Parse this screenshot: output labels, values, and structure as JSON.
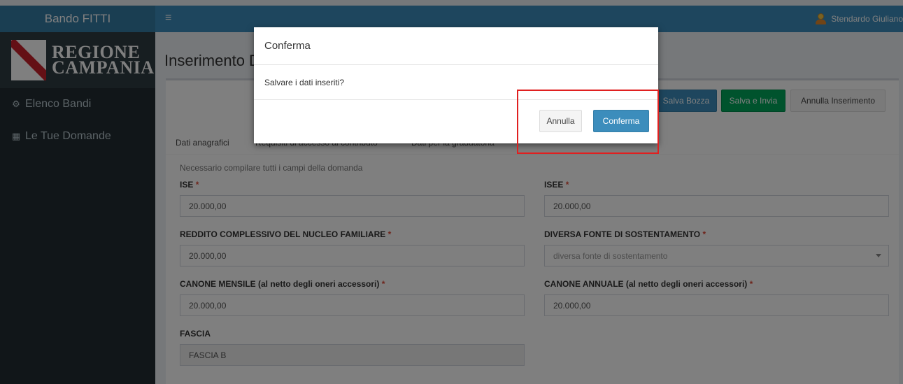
{
  "app": {
    "title": "Bando FITTI",
    "user_name": "Stendardo Giuliano"
  },
  "sidebar": {
    "logo_text_line1": "REGIONE",
    "logo_text_line2": "CAMPANIA",
    "items": [
      {
        "label": "Elenco Bandi",
        "icon": "car-icon"
      },
      {
        "label": "Le Tue Domande",
        "icon": "table-icon"
      }
    ]
  },
  "main": {
    "page_title": "Inserimento D",
    "buttons": {
      "salva_bozza": "Salva Bozza",
      "salva_invia": "Salva e Invia",
      "annulla_inserimento": "Annulla Inserimento"
    },
    "tabs": [
      "Dati anagrafici",
      "Requisiti di accesso al contributo",
      "Dati per la graduatoria"
    ],
    "hint": "Necessario compilare tutti i campi della domanda",
    "required_mark": "*",
    "fields": {
      "ise": {
        "label": "ISE",
        "value": "20.000,00"
      },
      "isee": {
        "label": "ISEE",
        "value": "20.000,00"
      },
      "reddito": {
        "label": "REDDITO COMPLESSIVO DEL NUCLEO FAMILIARE",
        "value": "20.000,00"
      },
      "diversa_fonte": {
        "label": "DIVERSA FONTE DI SOSTENTAMENTO",
        "placeholder": "diversa fonte di sostentamento"
      },
      "canone_mensile": {
        "label": "CANONE MENSILE (al netto degli oneri accessori)",
        "value": "20.000,00"
      },
      "canone_annuale": {
        "label": "CANONE ANNUALE (al netto degli oneri accessori)",
        "value": "20.000,00"
      },
      "fascia": {
        "label": "FASCIA",
        "value": "FASCIA B"
      }
    }
  },
  "modal": {
    "title": "Conferma",
    "message": "Salvare i dati inseriti?",
    "cancel_label": "Annulla",
    "confirm_label": "Conferma"
  },
  "colors": {
    "header": "#3c8dbc",
    "brand": "#357ca5",
    "sidebar": "#222d32",
    "primary": "#3c8dbc",
    "success": "#00a65a",
    "highlight": "#e02020"
  }
}
